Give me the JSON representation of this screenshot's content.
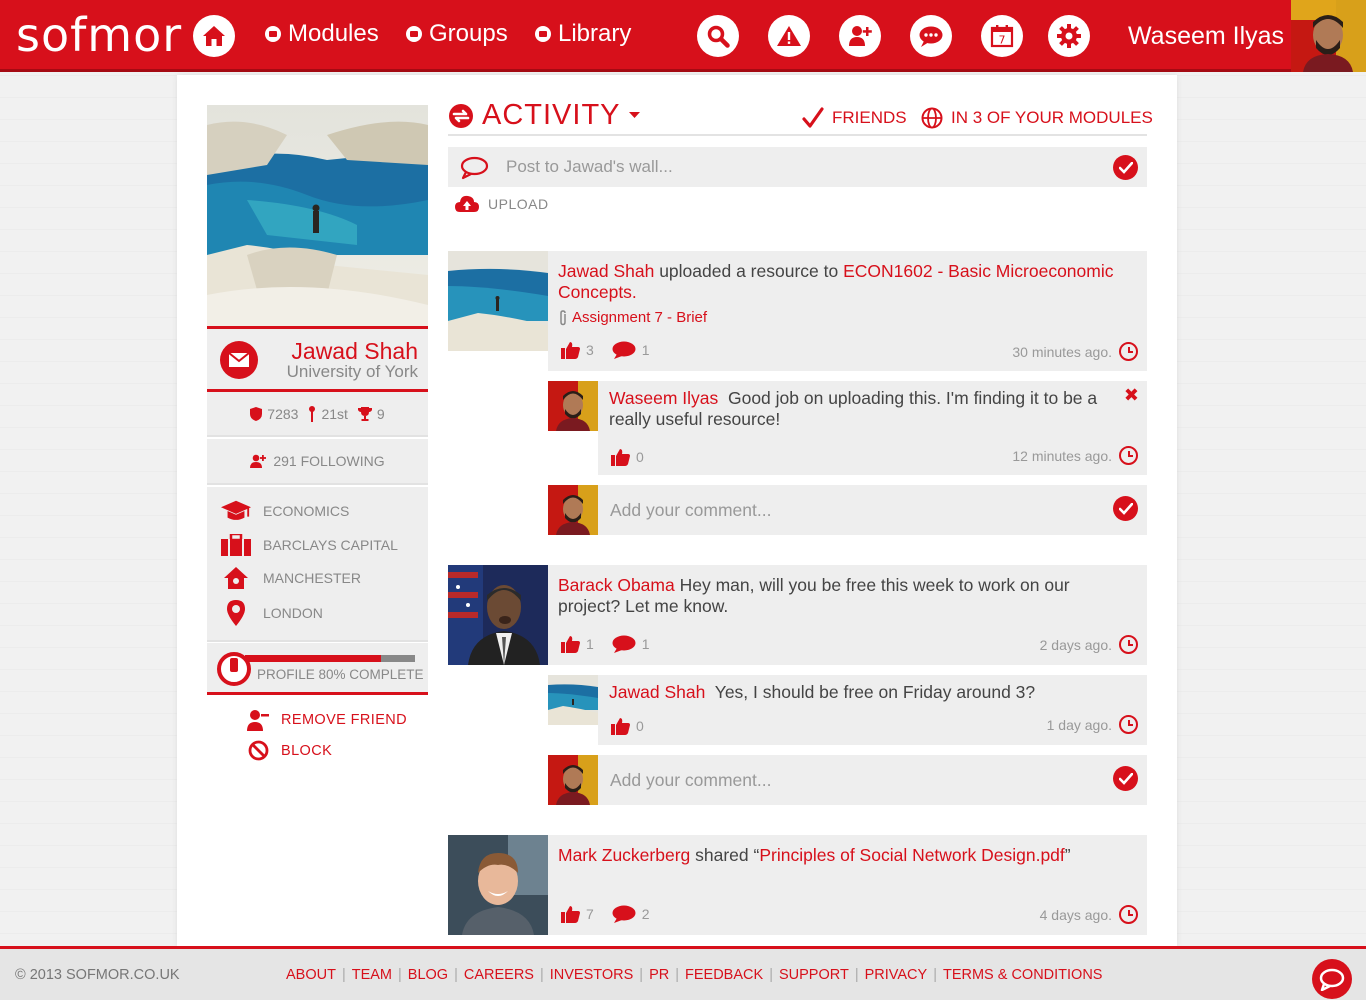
{
  "topbar": {
    "logo": "sofmor",
    "nav": [
      "Modules",
      "Groups",
      "Library"
    ],
    "user_name": "Waseem Ilyas"
  },
  "profile": {
    "name": "Jawad Shah",
    "university": "University of York",
    "points": "7283",
    "rank": "21st",
    "trophies": "9",
    "following": "291 FOLLOWING",
    "info": [
      "ECONOMICS",
      "BARCLAYS CAPITAL",
      "MANCHESTER",
      "LONDON"
    ],
    "progress_text": "PROFILE 80% COMPLETE",
    "progress_percent": 80,
    "remove_friend": "REMOVE FRIEND",
    "block": "BLOCK"
  },
  "activity": {
    "title": "ACTIVITY",
    "filter_friends": "FRIENDS",
    "filter_modules": "IN 3 OF YOUR MODULES",
    "post_placeholder": "Post to Jawad's wall...",
    "upload": "UPLOAD"
  },
  "feed": [
    {
      "author": "Jawad Shah",
      "action": "uploaded a resource to",
      "target": "ECON1602 - Basic Microeconomic Concepts.",
      "attachment": "Assignment 7 - Brief",
      "likes": "3",
      "comments": "1",
      "time": "30 minutes ago.",
      "replies": [
        {
          "author": "Waseem Ilyas",
          "text": "Good job on uploading this. I'm finding it to be a really useful resource!",
          "likes": "0",
          "time": "12 minutes ago."
        }
      ],
      "comment_placeholder": "Add your comment..."
    },
    {
      "author": "Barack Obama",
      "text": "Hey man, will you be free this week to work on our project? Let me know.",
      "likes": "1",
      "comments": "1",
      "time": "2 days ago.",
      "replies": [
        {
          "author": "Jawad Shah",
          "text": "Yes, I should be free on Friday around 3?",
          "likes": "0",
          "time": "1 day ago."
        }
      ],
      "comment_placeholder": "Add your comment..."
    },
    {
      "author": "Mark Zuckerberg",
      "action": "shared",
      "target": "“Principles of Social Network Design.pdf”",
      "target_inner": "Principles of Social Network Design.pdf",
      "likes": "7",
      "comments": "2",
      "time": "4 days ago."
    }
  ],
  "footer": {
    "copyright": "© 2013 SOFMOR.CO.UK",
    "links": [
      "ABOUT",
      "TEAM",
      "BLOG",
      "CAREERS",
      "INVESTORS",
      "PR",
      "FEEDBACK",
      "SUPPORT",
      "PRIVACY",
      "TERMS & CONDITIONS"
    ]
  },
  "icons": {
    "home": "home-icon",
    "search": "search-icon",
    "alert": "alert-icon",
    "add_friend": "add-friend-icon",
    "messages": "chat-icon",
    "calendar": "calendar-icon",
    "settings": "gear-icon"
  },
  "colors": {
    "brand": "#d7101b",
    "panel": "#eeeeee"
  }
}
